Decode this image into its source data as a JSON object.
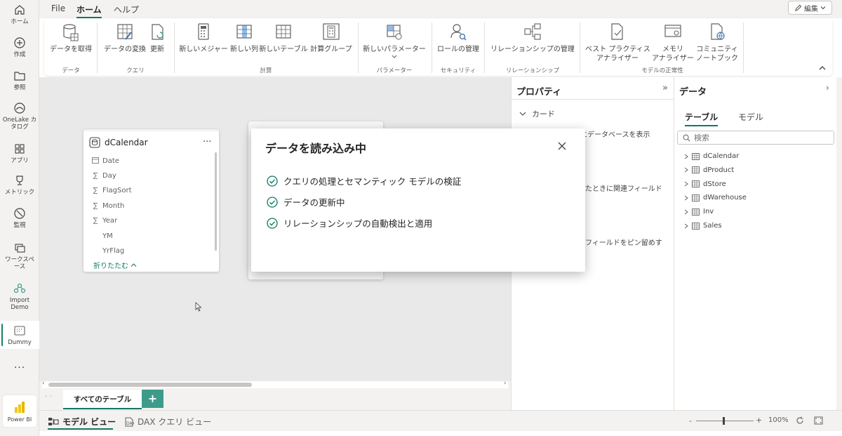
{
  "nav": {
    "home": "ホーム",
    "create": "作成",
    "browse": "参照",
    "onelake": "OneLake カタログ",
    "apps": "アプリ",
    "metrics": "メトリック",
    "monitor": "監視",
    "workspace": "ワークスペース",
    "import_demo": "Import Demo",
    "dummy": "Dummy",
    "more": "...",
    "powerbi": "Power BI"
  },
  "menu": {
    "file": "File",
    "home": "ホーム",
    "help": "ヘルプ",
    "edit": "編集"
  },
  "ribbon": {
    "get_data": "データを取得",
    "transform": "データの変換",
    "refresh": "更新",
    "new_measure": "新しいメジャー",
    "new_column": "新しい列",
    "new_table": "新しいテーブル",
    "calc_group": "計算グループ",
    "new_param": "新しいパラメーター",
    "manage_roles": "ロールの管理",
    "manage_rel": "リレーションシップの管理",
    "bpa_1": "ベスト プラクティス",
    "bpa_2": "アナライザー",
    "mem_1": "メモリ",
    "mem_2": "アナライザー",
    "comm_1": "コミュニティ",
    "comm_2": "ノートブック",
    "g_data": "データ",
    "g_query": "クエリ",
    "g_calc": "計算",
    "g_param": "パラメーター",
    "g_security": "セキュリティ",
    "g_rel": "リレーションシップ",
    "g_model": "モデルの正常性"
  },
  "table_card": {
    "title": "dCalendar",
    "more": "...",
    "fields": [
      {
        "icon": "calendar",
        "name": "Date"
      },
      {
        "icon": "sigma",
        "name": "Day"
      },
      {
        "icon": "sigma",
        "name": "FlagSort"
      },
      {
        "icon": "sigma",
        "name": "Month"
      },
      {
        "icon": "sigma",
        "name": "Year"
      },
      {
        "icon": "none",
        "name": "YM"
      },
      {
        "icon": "none",
        "name": "YrFlag"
      }
    ],
    "collapse": "折りたたむ"
  },
  "dialog": {
    "title": "データを読み込み中",
    "steps": [
      "クエリの処理とセマンティック モデルの検証",
      "データの更新中",
      "リレーションシップの自動検出と適用"
    ]
  },
  "properties": {
    "title": "プロパティ",
    "section": "カード",
    "partial_1": "ーにデータベースを表示",
    "partial_2": "たときに関連フィールド",
    "partial_3": "フィールドをピン留めす"
  },
  "data_pane": {
    "title": "データ",
    "tab_tables": "テーブル",
    "tab_model": "モデル",
    "search_placeholder": "検索",
    "tables": [
      "dCalendar",
      "dProduct",
      "dStore",
      "dWarehouse",
      "Inv",
      "Sales"
    ]
  },
  "tabs": {
    "all_tables": "すべてのテーブル",
    "add": "+"
  },
  "status": {
    "model_view": "モデル ビュー",
    "dax_view": "DAX クエリ ビュー",
    "zoom": "100%",
    "minus": "-",
    "plus": "+"
  },
  "colors": {
    "accent": "#117865",
    "add_tab": "#3d9b8a"
  }
}
